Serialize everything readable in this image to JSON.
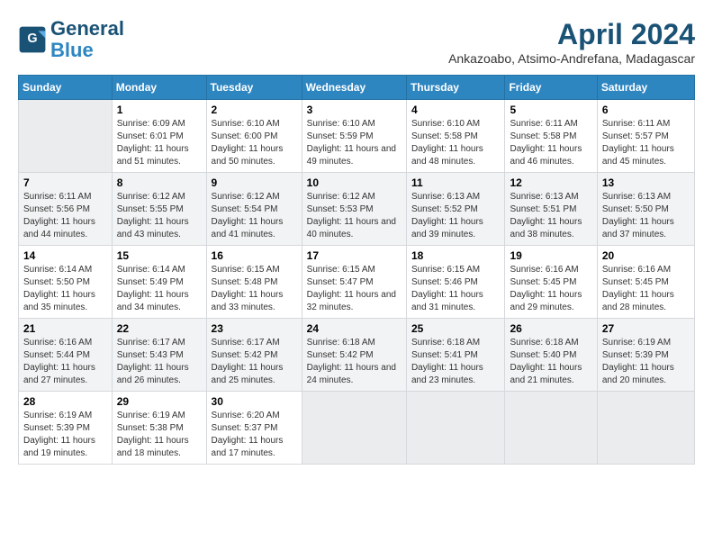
{
  "header": {
    "logo_line1": "General",
    "logo_line2": "Blue",
    "month_title": "April 2024",
    "location": "Ankazoabo, Atsimo-Andrefana, Madagascar"
  },
  "weekdays": [
    "Sunday",
    "Monday",
    "Tuesday",
    "Wednesday",
    "Thursday",
    "Friday",
    "Saturday"
  ],
  "weeks": [
    [
      {
        "day": "",
        "sunrise": "",
        "sunset": "",
        "daylight": ""
      },
      {
        "day": "1",
        "sunrise": "6:09 AM",
        "sunset": "6:01 PM",
        "daylight": "11 hours and 51 minutes."
      },
      {
        "day": "2",
        "sunrise": "6:10 AM",
        "sunset": "6:00 PM",
        "daylight": "11 hours and 50 minutes."
      },
      {
        "day": "3",
        "sunrise": "6:10 AM",
        "sunset": "5:59 PM",
        "daylight": "11 hours and 49 minutes."
      },
      {
        "day": "4",
        "sunrise": "6:10 AM",
        "sunset": "5:58 PM",
        "daylight": "11 hours and 48 minutes."
      },
      {
        "day": "5",
        "sunrise": "6:11 AM",
        "sunset": "5:58 PM",
        "daylight": "11 hours and 46 minutes."
      },
      {
        "day": "6",
        "sunrise": "6:11 AM",
        "sunset": "5:57 PM",
        "daylight": "11 hours and 45 minutes."
      }
    ],
    [
      {
        "day": "7",
        "sunrise": "6:11 AM",
        "sunset": "5:56 PM",
        "daylight": "11 hours and 44 minutes."
      },
      {
        "day": "8",
        "sunrise": "6:12 AM",
        "sunset": "5:55 PM",
        "daylight": "11 hours and 43 minutes."
      },
      {
        "day": "9",
        "sunrise": "6:12 AM",
        "sunset": "5:54 PM",
        "daylight": "11 hours and 41 minutes."
      },
      {
        "day": "10",
        "sunrise": "6:12 AM",
        "sunset": "5:53 PM",
        "daylight": "11 hours and 40 minutes."
      },
      {
        "day": "11",
        "sunrise": "6:13 AM",
        "sunset": "5:52 PM",
        "daylight": "11 hours and 39 minutes."
      },
      {
        "day": "12",
        "sunrise": "6:13 AM",
        "sunset": "5:51 PM",
        "daylight": "11 hours and 38 minutes."
      },
      {
        "day": "13",
        "sunrise": "6:13 AM",
        "sunset": "5:50 PM",
        "daylight": "11 hours and 37 minutes."
      }
    ],
    [
      {
        "day": "14",
        "sunrise": "6:14 AM",
        "sunset": "5:50 PM",
        "daylight": "11 hours and 35 minutes."
      },
      {
        "day": "15",
        "sunrise": "6:14 AM",
        "sunset": "5:49 PM",
        "daylight": "11 hours and 34 minutes."
      },
      {
        "day": "16",
        "sunrise": "6:15 AM",
        "sunset": "5:48 PM",
        "daylight": "11 hours and 33 minutes."
      },
      {
        "day": "17",
        "sunrise": "6:15 AM",
        "sunset": "5:47 PM",
        "daylight": "11 hours and 32 minutes."
      },
      {
        "day": "18",
        "sunrise": "6:15 AM",
        "sunset": "5:46 PM",
        "daylight": "11 hours and 31 minutes."
      },
      {
        "day": "19",
        "sunrise": "6:16 AM",
        "sunset": "5:45 PM",
        "daylight": "11 hours and 29 minutes."
      },
      {
        "day": "20",
        "sunrise": "6:16 AM",
        "sunset": "5:45 PM",
        "daylight": "11 hours and 28 minutes."
      }
    ],
    [
      {
        "day": "21",
        "sunrise": "6:16 AM",
        "sunset": "5:44 PM",
        "daylight": "11 hours and 27 minutes."
      },
      {
        "day": "22",
        "sunrise": "6:17 AM",
        "sunset": "5:43 PM",
        "daylight": "11 hours and 26 minutes."
      },
      {
        "day": "23",
        "sunrise": "6:17 AM",
        "sunset": "5:42 PM",
        "daylight": "11 hours and 25 minutes."
      },
      {
        "day": "24",
        "sunrise": "6:18 AM",
        "sunset": "5:42 PM",
        "daylight": "11 hours and 24 minutes."
      },
      {
        "day": "25",
        "sunrise": "6:18 AM",
        "sunset": "5:41 PM",
        "daylight": "11 hours and 23 minutes."
      },
      {
        "day": "26",
        "sunrise": "6:18 AM",
        "sunset": "5:40 PM",
        "daylight": "11 hours and 21 minutes."
      },
      {
        "day": "27",
        "sunrise": "6:19 AM",
        "sunset": "5:39 PM",
        "daylight": "11 hours and 20 minutes."
      }
    ],
    [
      {
        "day": "28",
        "sunrise": "6:19 AM",
        "sunset": "5:39 PM",
        "daylight": "11 hours and 19 minutes."
      },
      {
        "day": "29",
        "sunrise": "6:19 AM",
        "sunset": "5:38 PM",
        "daylight": "11 hours and 18 minutes."
      },
      {
        "day": "30",
        "sunrise": "6:20 AM",
        "sunset": "5:37 PM",
        "daylight": "11 hours and 17 minutes."
      },
      {
        "day": "",
        "sunrise": "",
        "sunset": "",
        "daylight": ""
      },
      {
        "day": "",
        "sunrise": "",
        "sunset": "",
        "daylight": ""
      },
      {
        "day": "",
        "sunrise": "",
        "sunset": "",
        "daylight": ""
      },
      {
        "day": "",
        "sunrise": "",
        "sunset": "",
        "daylight": ""
      }
    ]
  ],
  "labels": {
    "sunrise_prefix": "Sunrise: ",
    "sunset_prefix": "Sunset: ",
    "daylight_prefix": "Daylight: "
  }
}
